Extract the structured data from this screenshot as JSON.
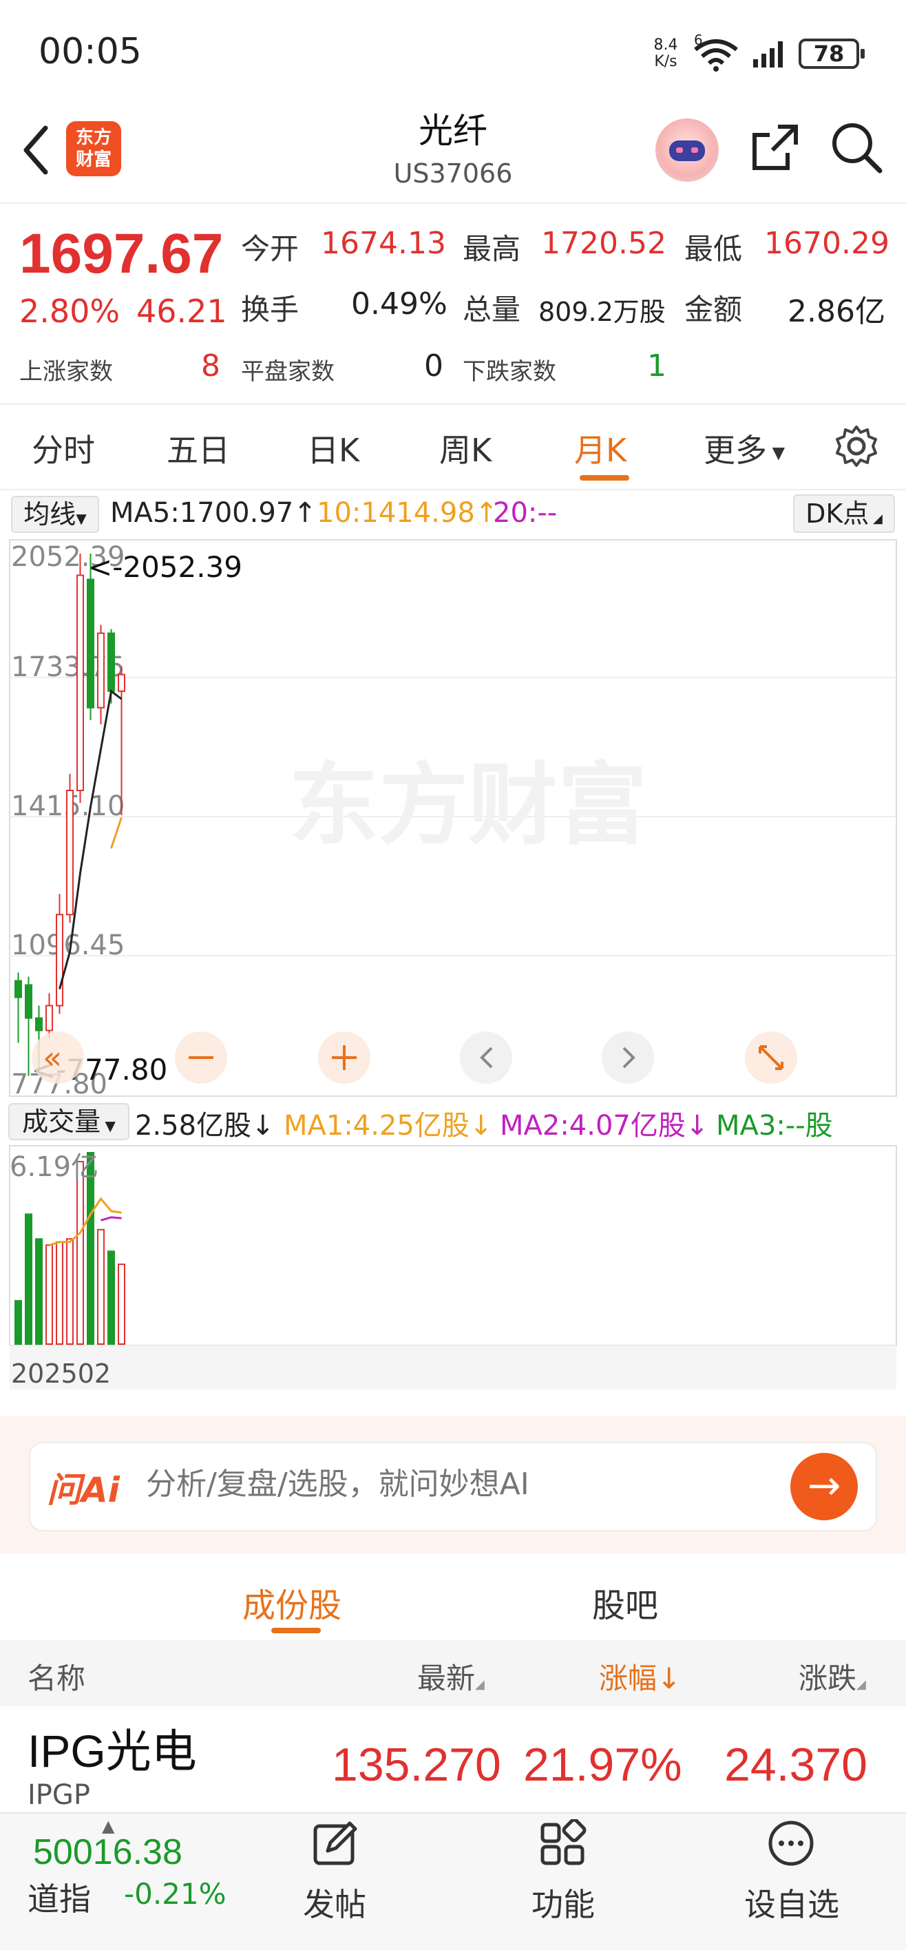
{
  "status_bar": {
    "time": "00:05",
    "net_speed_value": "8.4",
    "net_speed_unit": "K/s",
    "signal_label": "6",
    "battery": "78"
  },
  "header": {
    "back_icon": "chevron-left-icon",
    "logo_text_line1": "东方",
    "logo_text_line2": "财富",
    "title": "光纤",
    "code": "US37066",
    "ai_avatar_icon": "robot-avatar-icon",
    "share_icon": "share-icon",
    "search_icon": "search-icon"
  },
  "quote": {
    "price": "1697.67",
    "change_pct": "2.80%",
    "change": "46.21",
    "open_label": "今开",
    "open": "1674.13",
    "high_label": "最高",
    "high": "1720.52",
    "low_label": "最低",
    "low": "1670.29",
    "turnover_label": "换手",
    "turnover": "0.49%",
    "volume_label": "总量",
    "volume": "809.2万股",
    "amount_label": "金额",
    "amount": "2.86亿",
    "rise_label": "上涨家数",
    "rise": "8",
    "flat_label": "平盘家数",
    "flat": "0",
    "fall_label": "下跌家数",
    "fall": "1"
  },
  "chart_tabs": {
    "items": [
      "分时",
      "五日",
      "日K",
      "周K",
      "月K",
      "更多"
    ],
    "active": "月K"
  },
  "ma_legend": {
    "selector": "均线",
    "ma5": "MA5:1700.97↑",
    "ma10": "10:1414.98↑",
    "ma20": "20:--",
    "dk": "DK点"
  },
  "price_chart": {
    "y_ticks": [
      "2052.39",
      "1733.75",
      "1415.10",
      "1096.45",
      "777.80"
    ],
    "max_marker": "<-2052.39",
    "min_marker": "<-777.80"
  },
  "volume_legend": {
    "selector": "成交量",
    "current": "2.58亿股↓",
    "ma1": "MA1:4.25亿股↓",
    "ma2": "MA2:4.07亿股↓",
    "ma3": "MA3:--股",
    "max_tick": "6.19亿",
    "date_label": "202502"
  },
  "chart_data": {
    "type": "candlestick",
    "y_range": [
      777.8,
      2052.39
    ],
    "candles": [
      {
        "open": 1020,
        "close": 980,
        "high": 1040,
        "low": 870
      },
      {
        "open": 1010,
        "close": 930,
        "high": 1030,
        "low": 790
      },
      {
        "open": 930,
        "close": 900,
        "high": 960,
        "low": 800
      },
      {
        "open": 900,
        "close": 960,
        "high": 990,
        "low": 880
      },
      {
        "open": 960,
        "close": 1180,
        "high": 1230,
        "low": 940
      },
      {
        "open": 1180,
        "close": 1480,
        "high": 1520,
        "low": 1160
      },
      {
        "open": 1480,
        "close": 2000,
        "high": 2052.39,
        "low": 1450
      },
      {
        "open": 1990,
        "close": 1680,
        "high": 2052.39,
        "low": 1650
      },
      {
        "open": 1680,
        "close": 1860,
        "high": 1880,
        "low": 1640
      },
      {
        "open": 1860,
        "close": 1720,
        "high": 1870,
        "low": 1690
      },
      {
        "open": 1720,
        "close": 1760,
        "high": 1780,
        "low": 1420
      }
    ],
    "ma5": [
      null,
      null,
      null,
      null,
      1000,
      1090,
      1280,
      1440,
      1580,
      1720,
      1700.97
    ],
    "ma10": [
      null,
      null,
      null,
      null,
      null,
      null,
      null,
      null,
      null,
      1340,
      1414.98
    ],
    "volume": {
      "max": 6.19,
      "unit": "亿股",
      "values": [
        1.4,
        4.2,
        3.4,
        3.2,
        3.3,
        3.4,
        5.9,
        6.19,
        3.7,
        3.0,
        2.58
      ],
      "ma1": [
        null,
        null,
        null,
        3.2,
        3.3,
        3.3,
        3.6,
        4.2,
        4.7,
        4.3,
        4.25
      ],
      "ma2": [
        null,
        null,
        null,
        null,
        null,
        null,
        null,
        null,
        4.0,
        4.1,
        4.07
      ]
    },
    "colors": {
      "up": "#e0312f",
      "down": "#1a9a2a",
      "ma5": "#222222",
      "ma10": "#f0a020",
      "ma2": "#c020c0"
    }
  },
  "chart_controls": {
    "scroll_left_icon": "double-chevron-left-icon",
    "zoom_out_icon": "minus-icon",
    "zoom_in_icon": "plus-icon",
    "prev_icon": "chevron-left-icon",
    "next_icon": "chevron-right-icon",
    "fullscreen_icon": "expand-icon",
    "watermark": "东方财富"
  },
  "ai_bar": {
    "logo": "问Ai",
    "placeholder": "分析/复盘/选股，就问妙想AI"
  },
  "constituents": {
    "tabs": [
      "成份股",
      "股吧"
    ],
    "active_tab": "成份股",
    "columns": [
      "名称",
      "最新",
      "涨幅↓",
      "涨跌"
    ],
    "rows": [
      {
        "name": "IPG光电",
        "code": "IPGP",
        "latest": "135.270",
        "pct": "21.97%",
        "change": "24.370"
      }
    ]
  },
  "bottom_bar": {
    "index_value": "50016.38",
    "index_name": "道指",
    "index_pct": "-0.21%",
    "nav": [
      "发帖",
      "功能",
      "设自选"
    ]
  }
}
